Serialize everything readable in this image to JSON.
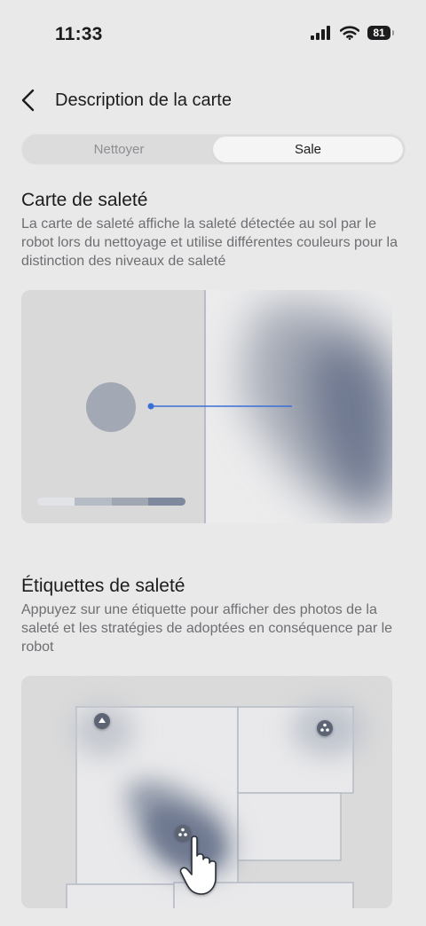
{
  "status_bar": {
    "time": "11:33",
    "battery": "81"
  },
  "nav": {
    "title": "Description de la carte"
  },
  "tabs": [
    {
      "label": "Nettoyer",
      "selected": false
    },
    {
      "label": "Sale",
      "selected": true
    }
  ],
  "dirt_map": {
    "title": "Carte de saleté",
    "description": "La carte de saleté affiche la saleté détectée au sol par le robot lors du nettoyage et utilise différentes couleurs pour la distinction des niveaux de saleté"
  },
  "dirt_labels": {
    "title": "Étiquettes de saleté",
    "description": "Appuyez sur une étiquette pour afficher des photos de la saleté et les stratégies de adoptées en conséquence par le robot"
  },
  "colors": {
    "background": "#e9e9e9",
    "accent_line": "#3b6fd6",
    "dirt_dark": "#6e7890",
    "dirt_circle": "#a3a9b4"
  }
}
